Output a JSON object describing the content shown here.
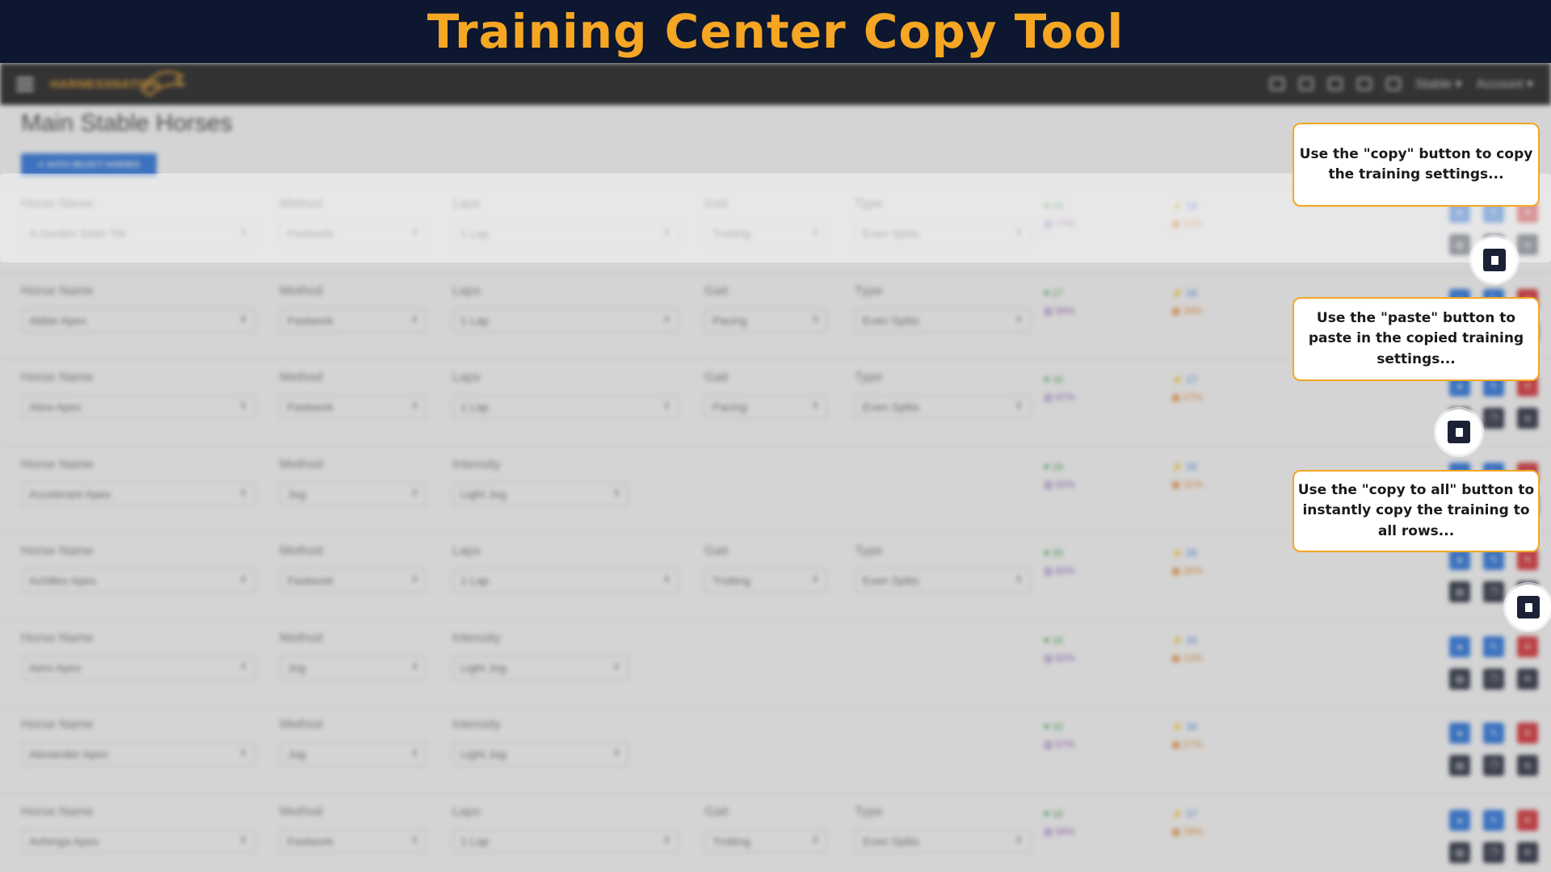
{
  "banner": {
    "title": "Training Center Copy Tool"
  },
  "navbar": {
    "logo": "HARNESSNATION",
    "stable_label": "Stable ▾",
    "account_label": "Account ▾"
  },
  "page": {
    "title": "Main Stable Horses",
    "auto_select_label": "✔ AUTO SELECT HORSES"
  },
  "labels": {
    "horse_name": "Horse Name",
    "method": "Method",
    "laps": "Laps",
    "intensity": "Intensity",
    "gait": "Gait",
    "type": "Type"
  },
  "rows": [
    {
      "horse": "A Garden State TM",
      "method": "Fastwork",
      "third_label": "Laps",
      "third": "1 Lap",
      "gait": "Trotting",
      "type": "Even Splits",
      "s1": "19",
      "s2": "77%",
      "s3": "19",
      "s4": "23%"
    },
    {
      "horse": "Abbie Apex",
      "method": "Fastwork",
      "third_label": "Laps",
      "third": "1 Lap",
      "gait": "Pacing",
      "type": "Even Splits",
      "s1": "17",
      "s2": "94%",
      "s3": "16",
      "s4": "26%"
    },
    {
      "horse": "Abra Apex",
      "method": "Fastwork",
      "third_label": "Laps",
      "third": "1 Lap",
      "gait": "Pacing",
      "type": "Even Splits",
      "s1": "16",
      "s2": "97%",
      "s3": "17",
      "s4": "27%"
    },
    {
      "horse": "Accelerant Apex",
      "method": "Jog",
      "third_label": "Intensity",
      "third": "Light Jog",
      "gait": "",
      "type": "",
      "s1": "16",
      "s2": "92%",
      "s3": "16",
      "s4": "31%"
    },
    {
      "horse": "Achilles Apex",
      "method": "Fastwork",
      "third_label": "Laps",
      "third": "1 Lap",
      "gait": "Trotting",
      "type": "Even Splits",
      "s1": "20",
      "s2": "82%",
      "s3": "20",
      "s4": "26%"
    },
    {
      "horse": "Aero Apex",
      "method": "Jog",
      "third_label": "Intensity",
      "third": "Light Jog",
      "gait": "",
      "type": "",
      "s1": "16",
      "s2": "82%",
      "s3": "15",
      "s4": "13%"
    },
    {
      "horse": "Alexander Apex",
      "method": "Jog",
      "third_label": "Intensity",
      "third": "Light Jog",
      "gait": "",
      "type": "",
      "s1": "15",
      "s2": "97%",
      "s3": "16",
      "s4": "27%"
    },
    {
      "horse": "Anhinga Apex",
      "method": "Fastwork",
      "third_label": "Laps",
      "third": "1 Lap",
      "gait": "Trotting",
      "type": "Even Splits",
      "s1": "16",
      "s2": "94%",
      "s3": "17",
      "s4": "29%"
    }
  ],
  "callouts": {
    "copy": "Use the \"copy\" button to copy the training settings...",
    "paste": "Use the \"paste\" button to paste in the copied training settings...",
    "copy_all": "Use the \"copy to all\" button to instantly copy the training to all rows..."
  },
  "colors": {
    "banner_bg": "#0d1730",
    "banner_text": "#f5a623",
    "callout_border": "#f5a623",
    "button_blue": "#1f6fe0",
    "button_red": "#d9262e",
    "button_dark": "#1b2236"
  }
}
